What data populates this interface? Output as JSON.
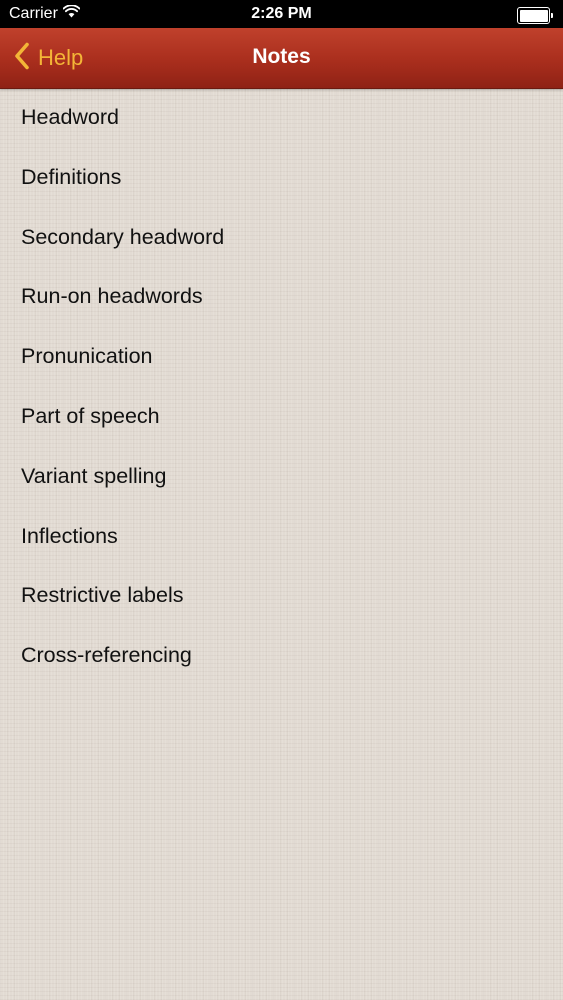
{
  "status_bar": {
    "carrier": "Carrier",
    "time": "2:26 PM",
    "battery_level": 1.0,
    "icons": [
      "wifi-icon",
      "battery-icon"
    ]
  },
  "nav": {
    "back_label": "Help",
    "title": "Notes",
    "back_icon": "chevron-left-icon"
  },
  "colors": {
    "nav_red": "#a92e1d",
    "back_gold": "#f3b537",
    "linen": "#e2dbd3"
  },
  "items": [
    {
      "label": "Headword"
    },
    {
      "label": "Definitions"
    },
    {
      "label": "Secondary headword"
    },
    {
      "label": "Run-on headwords"
    },
    {
      "label": "Pronunication"
    },
    {
      "label": "Part of speech"
    },
    {
      "label": "Variant spelling"
    },
    {
      "label": "Inflections"
    },
    {
      "label": "Restrictive labels"
    },
    {
      "label": "Cross-referencing"
    }
  ]
}
